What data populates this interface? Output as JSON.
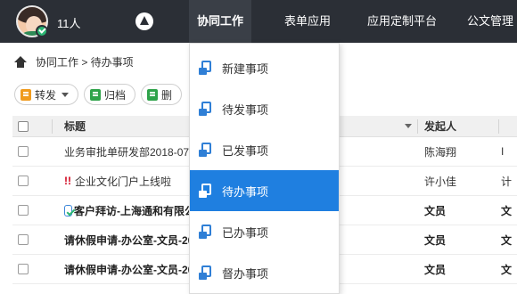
{
  "header": {
    "user_count": "11人",
    "nav": [
      {
        "label": "协同工作",
        "active": true
      },
      {
        "label": "表单应用",
        "active": false
      },
      {
        "label": "应用定制平台",
        "active": false
      },
      {
        "label": "公文管理",
        "active": false
      }
    ]
  },
  "breadcrumb": {
    "text": "协同工作 > 待办事项"
  },
  "toolbar": {
    "forward_label": "转发",
    "archive_label": "归档",
    "delete_label": "删"
  },
  "table": {
    "columns": {
      "title": "标题",
      "sender": "发起人"
    },
    "rows": [
      {
        "title": "业务审批单研发部2018-07-",
        "sender": "陈海翔",
        "last": "I",
        "bold": false
      },
      {
        "title": "企业文化门户上线啦",
        "sender": "许小佳",
        "last": "计",
        "bold": false,
        "urgent": "!!"
      },
      {
        "title": "客户拜访-上海通和有限公",
        "sender": "文员",
        "last": "文",
        "bold": true
      },
      {
        "title": "请休假申请-办公室-文员-20",
        "sender": "文员",
        "last": "文",
        "bold": true
      },
      {
        "title": "请休假申请-办公室-文员-20",
        "sender": "文员",
        "last": "文",
        "bold": true
      }
    ]
  },
  "dropdown": {
    "items": [
      {
        "label": "新建事项",
        "active": false
      },
      {
        "label": "待发事项",
        "active": false
      },
      {
        "label": "已发事项",
        "active": false
      },
      {
        "label": "待办事项",
        "active": true
      },
      {
        "label": "已办事项",
        "active": false
      },
      {
        "label": "督办事项",
        "active": false
      }
    ]
  },
  "colors": {
    "topbar": "#2b2f36",
    "accent": "#1f7fe0",
    "online": "#2bb673",
    "urgent": "#d0021b"
  }
}
